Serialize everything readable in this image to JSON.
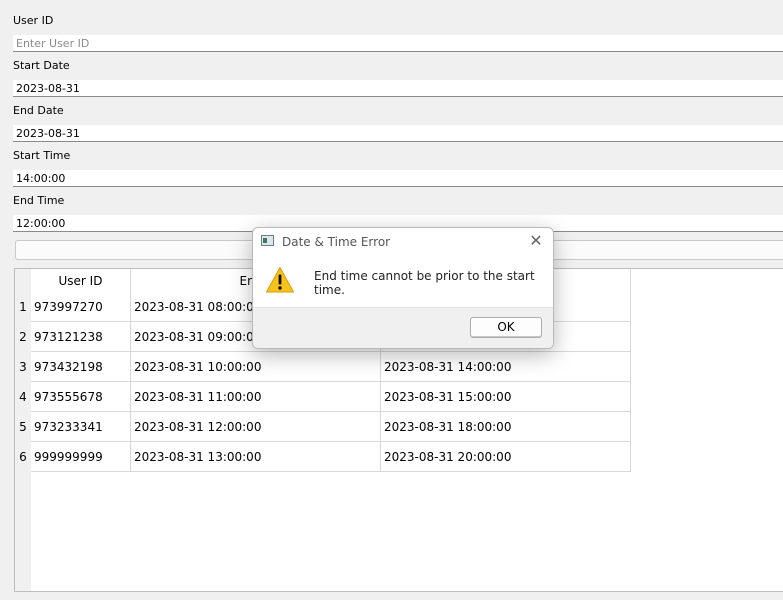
{
  "form": {
    "user_id_label": "User ID",
    "user_id_placeholder": "Enter User ID",
    "start_date_label": "Start Date",
    "start_date_value": "2023-08-31",
    "end_date_label": "End Date",
    "end_date_value": "2023-08-31",
    "start_time_label": "Start Time",
    "start_time_value": "14:00:00",
    "end_time_label": "End Time",
    "end_time_value": "12:00:00"
  },
  "table": {
    "headers": [
      "User ID",
      "Entry",
      ""
    ],
    "rows": [
      {
        "num": "1",
        "user_id": "973997270",
        "entry": "2023-08-31 08:00:00",
        "exit": ""
      },
      {
        "num": "2",
        "user_id": "973121238",
        "entry": "2023-08-31 09:00:00",
        "exit": ""
      },
      {
        "num": "3",
        "user_id": "973432198",
        "entry": "2023-08-31 10:00:00",
        "exit": "2023-08-31 14:00:00"
      },
      {
        "num": "4",
        "user_id": "973555678",
        "entry": "2023-08-31 11:00:00",
        "exit": "2023-08-31 15:00:00"
      },
      {
        "num": "5",
        "user_id": "973233341",
        "entry": "2023-08-31 12:00:00",
        "exit": "2023-08-31 18:00:00"
      },
      {
        "num": "6",
        "user_id": "999999999",
        "entry": "2023-08-31 13:00:00",
        "exit": "2023-08-31 20:00:00"
      }
    ]
  },
  "dialog": {
    "title": "Date & Time Error",
    "message": "End time cannot be prior to the start time.",
    "ok_label": "OK",
    "close_glyph": "✕",
    "icon": "warning-icon"
  },
  "colors": {
    "warning_fill": "#f8c21a",
    "background": "#f0f0f0"
  }
}
